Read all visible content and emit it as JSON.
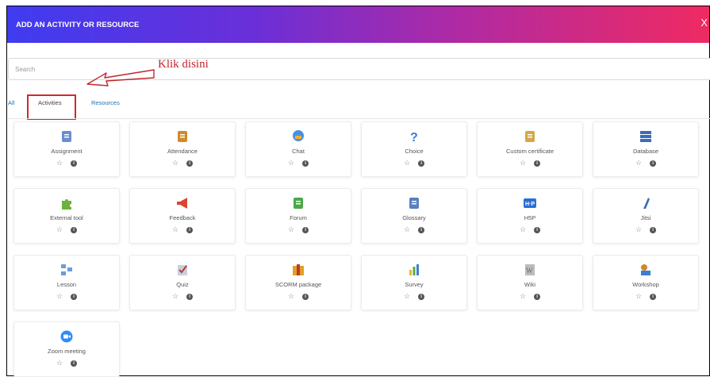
{
  "header": {
    "title": "ADD AN ACTIVITY OR RESOURCE",
    "close_label": "X"
  },
  "search": {
    "placeholder": "Search"
  },
  "annotation": {
    "text": "Klik disini"
  },
  "tabs": [
    {
      "label": "All"
    },
    {
      "label": "Activities"
    },
    {
      "label": "Resources"
    }
  ],
  "items": [
    {
      "label": "Assignment",
      "icon": "assignment-icon",
      "color": "#6a8fd0"
    },
    {
      "label": "Attendance",
      "icon": "attendance-icon",
      "color": "#d08a2a"
    },
    {
      "label": "Chat",
      "icon": "chat-icon",
      "color": "#4a90e2"
    },
    {
      "label": "Choice",
      "icon": "choice-icon",
      "color": "#3b7dd8"
    },
    {
      "label": "Custom certificate",
      "icon": "certificate-icon",
      "color": "#d4a84a"
    },
    {
      "label": "Database",
      "icon": "database-icon",
      "color": "#3a6db5"
    },
    {
      "label": "External tool",
      "icon": "puzzle-icon",
      "color": "#6bb33a"
    },
    {
      "label": "Feedback",
      "icon": "megaphone-icon",
      "color": "#d9452f"
    },
    {
      "label": "Forum",
      "icon": "forum-icon",
      "color": "#4aa84a"
    },
    {
      "label": "Glossary",
      "icon": "glossary-icon",
      "color": "#5a7fc0"
    },
    {
      "label": "H5P",
      "icon": "h5p-icon",
      "color": "#2a6fd6"
    },
    {
      "label": "Jitsi",
      "icon": "jitsi-icon",
      "color": "#3a6fb5"
    },
    {
      "label": "Lesson",
      "icon": "lesson-icon",
      "color": "#6a9fd8"
    },
    {
      "label": "Quiz",
      "icon": "quiz-icon",
      "color": "#c0392b"
    },
    {
      "label": "SCORM package",
      "icon": "scorm-icon",
      "color": "#e0a02a"
    },
    {
      "label": "Survey",
      "icon": "survey-icon",
      "color": "#5aa83a"
    },
    {
      "label": "Wiki",
      "icon": "wiki-icon",
      "color": "#666666"
    },
    {
      "label": "Workshop",
      "icon": "workshop-icon",
      "color": "#d08a2a"
    },
    {
      "label": "Zoom meeting",
      "icon": "zoom-icon",
      "color": "#2d8cff"
    }
  ]
}
